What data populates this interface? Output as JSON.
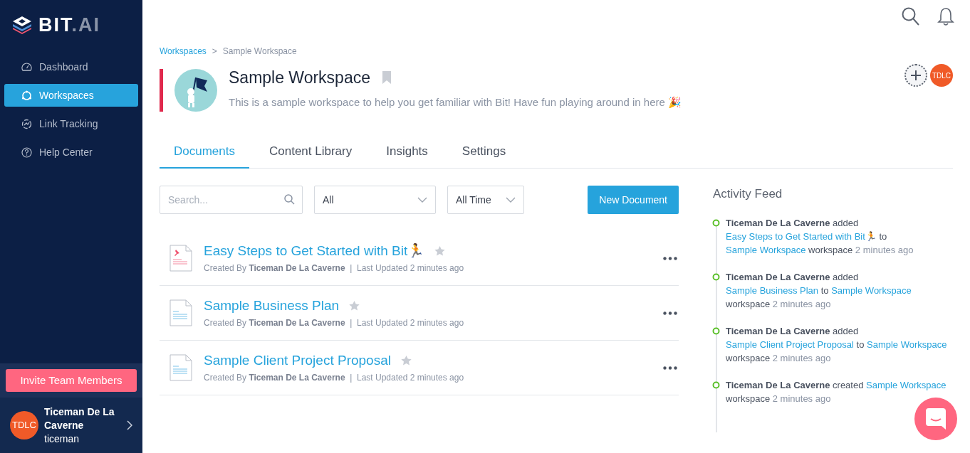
{
  "logo": {
    "primary": "BIT",
    "secondary": ".AI"
  },
  "sidebar": {
    "items": [
      {
        "label": "Dashboard",
        "kind": "gauge",
        "selected": false
      },
      {
        "label": "Workspaces",
        "kind": "circle",
        "selected": true
      },
      {
        "label": "Link Tracking",
        "kind": "link",
        "selected": false
      },
      {
        "label": "Help Center",
        "kind": "help",
        "selected": false
      }
    ],
    "invite_button": "Invite Team Members",
    "user": {
      "initials": "TDLC",
      "name": "Ticeman De La Caverne",
      "handle": "ticeman"
    }
  },
  "breadcrumb": [
    {
      "label": "Workspaces",
      "kind": "link"
    },
    {
      "label": ">",
      "kind": "separator"
    },
    {
      "label": "Sample Workspace",
      "kind": "current"
    }
  ],
  "workspace": {
    "title": "Sample Workspace",
    "description": "This is a sample workspace to help you get familiar with Bit! Have fun playing around in here 🎉",
    "member_initials": "TDLC"
  },
  "tabs": [
    {
      "label": "Documents",
      "selected": true
    },
    {
      "label": "Content Library",
      "selected": false
    },
    {
      "label": "Insights",
      "selected": false
    },
    {
      "label": "Settings",
      "selected": false
    }
  ],
  "filters": {
    "search": {
      "placeholder": "Search..."
    },
    "type": "All",
    "time": "All Time"
  },
  "new_document_button": "New Document",
  "documents": [
    {
      "title": "Easy Steps to Get Started with Bit🏃",
      "kind": "pinned",
      "meta": "Created By **Ticeman De La Caverne**  |  Last Updated 2 minutes ago"
    },
    {
      "title": "Sample Business Plan",
      "kind": "plain",
      "meta": "Created By **Ticeman De La Caverne**  |  Last Updated 2 minutes ago"
    },
    {
      "title": "Sample Client Project Proposal",
      "kind": "plain",
      "meta": "Created By **Ticeman De La Caverne**  |  Last Updated 2 minutes ago"
    }
  ],
  "activity_feed": {
    "title": "Activity Feed",
    "entries": [
      [
        {
          "kind": "actor",
          "text": "Ticeman De La Caverne"
        },
        {
          "kind": "plain",
          "text": " added "
        },
        {
          "kind": "link",
          "text": "Easy Steps to Get Started with Bit🏃"
        },
        {
          "kind": "plain",
          "text": " to "
        },
        {
          "kind": "link",
          "text": "Sample Workspace"
        },
        {
          "kind": "plain",
          "text": " workspace "
        },
        {
          "kind": "time",
          "text": "2 minutes ago"
        }
      ],
      [
        {
          "kind": "actor",
          "text": "Ticeman De La Caverne"
        },
        {
          "kind": "plain",
          "text": " added "
        },
        {
          "kind": "link",
          "text": "Sample Business Plan"
        },
        {
          "kind": "plain",
          "text": " to "
        },
        {
          "kind": "link",
          "text": "Sample Workspace"
        },
        {
          "kind": "plain",
          "text": " workspace "
        },
        {
          "kind": "time",
          "text": "2 minutes ago"
        }
      ],
      [
        {
          "kind": "actor",
          "text": "Ticeman De La Caverne"
        },
        {
          "kind": "plain",
          "text": " added "
        },
        {
          "kind": "link",
          "text": "Sample Client Project Proposal"
        },
        {
          "kind": "plain",
          "text": " to "
        },
        {
          "kind": "link",
          "text": "Sample Workspace"
        },
        {
          "kind": "plain",
          "text": " workspace "
        },
        {
          "kind": "time",
          "text": "2 minutes ago"
        }
      ],
      [
        {
          "kind": "actor",
          "text": "Ticeman De La Caverne"
        },
        {
          "kind": "plain",
          "text": " created "
        },
        {
          "kind": "link",
          "text": "Sample Workspace"
        },
        {
          "kind": "plain",
          "text": " workspace "
        },
        {
          "kind": "time",
          "text": "2 minutes ago"
        }
      ]
    ]
  }
}
